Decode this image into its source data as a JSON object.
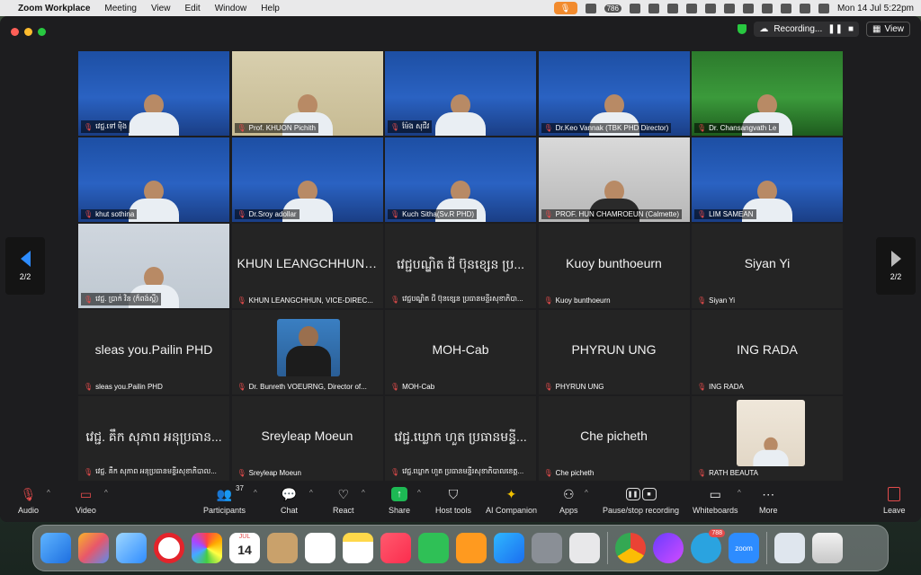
{
  "menubar": {
    "app": "Zoom Workplace",
    "items": [
      "Meeting",
      "View",
      "Edit",
      "Window",
      "Help"
    ],
    "datetime": "Mon 14 Jul  5:22pm",
    "badge": "786"
  },
  "window": {
    "recording_label": "Recording...",
    "view_label": "View"
  },
  "pager": {
    "left": "2/2",
    "right": "2/2"
  },
  "tiles": [
    {
      "name": "វេជ្ជ.ទៅ ម៉ិង",
      "type": "video",
      "bg": "blue",
      "muted": true
    },
    {
      "name": "Prof. KHUON Pichith",
      "type": "video",
      "bg": "beige",
      "muted": true
    },
    {
      "name": "ម៉ែង សុជីវ",
      "type": "video",
      "bg": "blue",
      "muted": true
    },
    {
      "name": "Dr.Keo Vannak (TBK PHD Director)",
      "type": "video",
      "bg": "blue",
      "muted": true
    },
    {
      "name": "Dr. Chansangvath Le",
      "type": "video",
      "bg": "green",
      "muted": true
    },
    {
      "name": "khut sothina",
      "type": "video",
      "bg": "blue",
      "muted": true
    },
    {
      "name": "Dr.Sroy adollar",
      "type": "video",
      "bg": "blue",
      "muted": true
    },
    {
      "name": "Kuch Sitha(Sv.R PHD)",
      "type": "video",
      "bg": "blue",
      "muted": true
    },
    {
      "name": "PROF. HUN CHAMROEUN (Calmette)",
      "type": "video",
      "bg": "gray",
      "muted": true
    },
    {
      "name": "LIM SAMEAN",
      "type": "video",
      "bg": "blue",
      "muted": true
    },
    {
      "name": "វេជ្ជ. ប្រាក់ វិន (ក៏ពង់ស្ពឺ)",
      "type": "video",
      "bg": "room",
      "muted": true
    },
    {
      "name": "KHUN LEANGCHHUN, VICE-DIREC...",
      "big": "KHUN LEANGCHHUN,...",
      "type": "name",
      "muted": true
    },
    {
      "name": "វេជ្ជបណ្ឌិត ជី ប៊ុនខ្សេន ប្រធានមន្ទីរសុខាភិបា...",
      "big": "វេជ្ជបណ្ឌិត ជី ប៊ុនខ្សេន ប្រ...",
      "type": "name",
      "muted": true
    },
    {
      "name": "Kuoy bunthoeurn",
      "big": "Kuoy bunthoeurn",
      "type": "name",
      "muted": true
    },
    {
      "name": "Siyan Yi",
      "big": "Siyan Yi",
      "type": "name",
      "muted": true
    },
    {
      "name": "sleas you.Pailin PHD",
      "big": "sleas you.Pailin PHD",
      "type": "name",
      "muted": true
    },
    {
      "name": "Dr. Bunreth VOEURNG, Director of...",
      "type": "avatar",
      "muted": true
    },
    {
      "name": "MOH-Cab",
      "big": "MOH-Cab",
      "type": "name",
      "muted": true
    },
    {
      "name": "PHYRUN UNG",
      "big": "PHYRUN UNG",
      "type": "name",
      "muted": true
    },
    {
      "name": "ING RADA",
      "big": "ING RADA",
      "type": "name",
      "muted": true
    },
    {
      "name": "វេជ្ជ. គឹក សុភាព អនុប្រធានមន្ទីរសុខាភិបាល...",
      "big": "វេជ្ជ. គឹក សុភាព អនុប្រធាន...",
      "type": "name",
      "muted": true
    },
    {
      "name": "Sreyleap Moeun",
      "big": "Sreyleap Moeun",
      "type": "name",
      "muted": true
    },
    {
      "name": "វេជ្ជ.ឃ្លោក ហួត ប្រធានមន្ទីរសុខាភិបាលខេត្ត...",
      "big": "វេជ្ជ.ឃ្លោក ហួត ប្រធានមន្ទី...",
      "type": "name",
      "muted": true
    },
    {
      "name": "Che picheth",
      "big": "Che picheth",
      "type": "name",
      "muted": true
    },
    {
      "name": "RATH BEAUTA",
      "type": "smallvideo",
      "muted": true
    }
  ],
  "toolbar": {
    "audio": "Audio",
    "video": "Video",
    "participants": "Participants",
    "participants_count": "37",
    "chat": "Chat",
    "react": "React",
    "share": "Share",
    "host_tools": "Host tools",
    "ai": "AI Companion",
    "apps": "Apps",
    "pause_stop": "Pause/stop recording",
    "whiteboards": "Whiteboards",
    "more": "More",
    "leave": "Leave"
  },
  "dock": {
    "calendar_month": "JUL",
    "calendar_day": "14",
    "telegram_badge": "788",
    "zoom_label": "zoom"
  },
  "colors": {
    "zoom_blue": "#2d8cff",
    "mute_red": "#e34b4b",
    "share_green": "#1db954"
  }
}
